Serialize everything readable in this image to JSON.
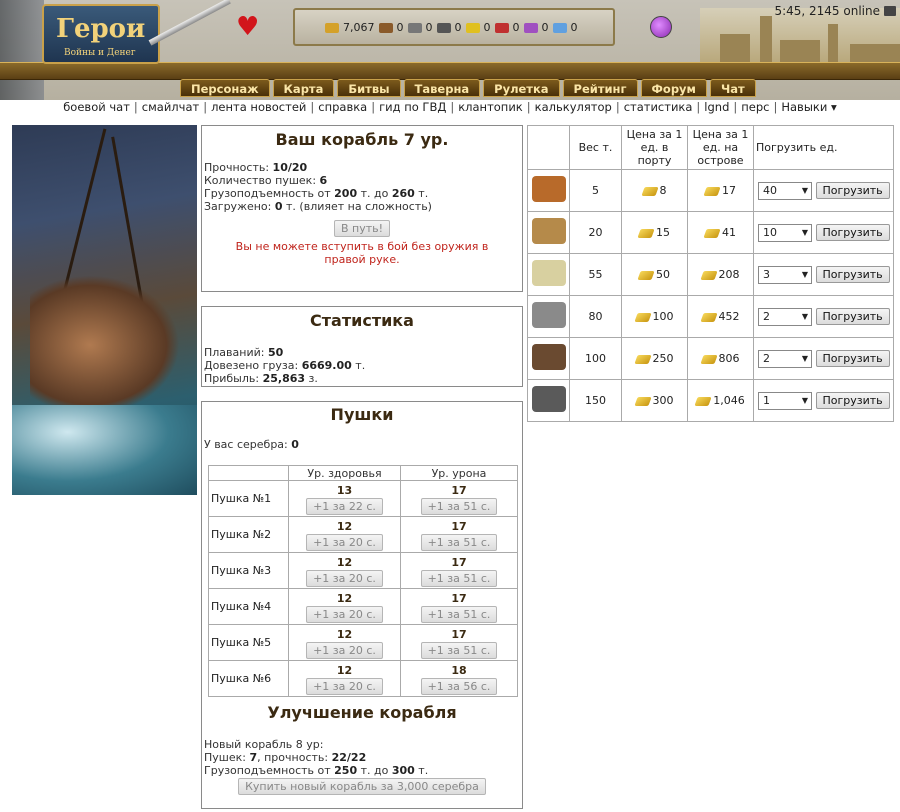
{
  "header": {
    "logo_title": "Герои",
    "logo_subtitle": "Войны и Денег",
    "clock": "5:45, 2145 online",
    "resources": [
      {
        "icon": "gold-icon",
        "value": "7,067",
        "color": "#d4a12a"
      },
      {
        "icon": "wood-icon",
        "value": "0",
        "color": "#8a5a2a"
      },
      {
        "icon": "ore-icon",
        "value": "0",
        "color": "#777777"
      },
      {
        "icon": "mercury-icon",
        "value": "0",
        "color": "#555555"
      },
      {
        "icon": "sulfur-icon",
        "value": "0",
        "color": "#e0c020"
      },
      {
        "icon": "crystal-icon",
        "value": "0",
        "color": "#c03030"
      },
      {
        "icon": "gems-icon",
        "value": "0",
        "color": "#a050c0"
      },
      {
        "icon": "diamond-icon",
        "value": "0",
        "color": "#60a0e0"
      }
    ],
    "nav": [
      "Персонаж",
      "Карта",
      "Битвы",
      "Таверна",
      "Рулетка",
      "Рейтинг",
      "Форум",
      "Чат"
    ],
    "sublinks": [
      "боевой чат",
      "смайлчат",
      "лента новостей",
      "справка",
      "гид по ГВД",
      "клантопик",
      "калькулятор",
      "статистика",
      "lgnd",
      "перс",
      "Навыки ▾"
    ]
  },
  "ship": {
    "title": "Ваш корабль 7 ур.",
    "durability_label": "Прочность: ",
    "durability": "10/20",
    "cannons_label": "Количество пушек: ",
    "cannons": "6",
    "capacity_label": "Грузоподъемность от ",
    "capacity_from": "200",
    "capacity_mid": " т. до ",
    "capacity_to": "260",
    "capacity_end": " т.",
    "loaded_label": "Загружено: ",
    "loaded": "0",
    "loaded_end": " т. (влияет на сложность)",
    "go_button": "В путь!",
    "error": "Вы не можете вступить в бой без оружия в правой руке."
  },
  "stats": {
    "title": "Статистика",
    "voyages_label": "Плаваний: ",
    "voyages": "50",
    "delivered_label": "Довезено груза: ",
    "delivered": "6669.00",
    "delivered_end": " т.",
    "profit_label": "Прибыль: ",
    "profit": "25,863",
    "profit_end": " з."
  },
  "cannons": {
    "title": "Пушки",
    "silver_label": "У вас серебра: ",
    "silver": "0",
    "col_health": "Ур. здоровья",
    "col_damage": "Ур. урона",
    "rows": [
      {
        "name": "Пушка №1",
        "health": "13",
        "health_btn": "+1 за 22 с.",
        "damage": "17",
        "damage_btn": "+1 за 51 с."
      },
      {
        "name": "Пушка №2",
        "health": "12",
        "health_btn": "+1 за 20 с.",
        "damage": "17",
        "damage_btn": "+1 за 51 с."
      },
      {
        "name": "Пушка №3",
        "health": "12",
        "health_btn": "+1 за 20 с.",
        "damage": "17",
        "damage_btn": "+1 за 51 с."
      },
      {
        "name": "Пушка №4",
        "health": "12",
        "health_btn": "+1 за 20 с.",
        "damage": "17",
        "damage_btn": "+1 за 51 с."
      },
      {
        "name": "Пушка №5",
        "health": "12",
        "health_btn": "+1 за 20 с.",
        "damage": "17",
        "damage_btn": "+1 за 51 с."
      },
      {
        "name": "Пушка №6",
        "health": "12",
        "health_btn": "+1 за 20 с.",
        "damage": "18",
        "damage_btn": "+1 за 56 с."
      }
    ]
  },
  "upgrade": {
    "title": "Улучшение корабля",
    "new_ship": "Новый корабль 8 ур:",
    "cannons_label": "Пушек: ",
    "cannons": "7",
    "durability_label": ", прочность: ",
    "durability": "22/22",
    "capacity_label": "Грузоподъемность от ",
    "capacity_from": "250",
    "capacity_mid": " т. до ",
    "capacity_to": "300",
    "capacity_end": " т.",
    "buy_button": "Купить новый корабль за 3,000 серебра"
  },
  "goods": {
    "col_weight": "Вес т.",
    "col_port": "Цена за 1 ед. в порту",
    "col_island": "Цена за 1 ед. на острове",
    "col_load": "Погрузить ед.",
    "load_button": "Погрузить",
    "rows": [
      {
        "icon": "fruits-icon",
        "color": "#b86a2a",
        "weight": "5",
        "port": "8",
        "island": "17",
        "qty": "40"
      },
      {
        "icon": "planks-icon",
        "color": "#b58a4a",
        "weight": "20",
        "port": "15",
        "island": "41",
        "qty": "10"
      },
      {
        "icon": "flour-icon",
        "color": "#d8d0a0",
        "weight": "55",
        "port": "50",
        "island": "208",
        "qty": "3"
      },
      {
        "icon": "gravel-icon",
        "color": "#8a8a8a",
        "weight": "80",
        "port": "100",
        "island": "452",
        "qty": "2"
      },
      {
        "icon": "pot-icon",
        "color": "#6a4a30",
        "weight": "100",
        "port": "250",
        "island": "806",
        "qty": "2"
      },
      {
        "icon": "metal-bars-icon",
        "color": "#5a5a5a",
        "weight": "150",
        "port": "300",
        "island": "1,046",
        "qty": "1"
      }
    ]
  }
}
